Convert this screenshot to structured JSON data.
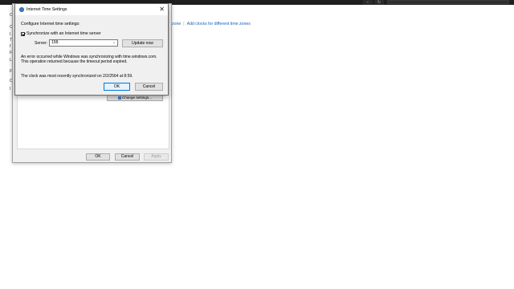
{
  "background": {
    "links": {
      "left_partial": "zone",
      "right": "Add clocks for different time zones"
    },
    "edge_letters": [
      "C",
      "C",
      "I",
      "T",
      "f",
      "F",
      "L",
      "F",
      "C",
      "I"
    ]
  },
  "date_time_dialog": {
    "change_settings_label": "Change settings...",
    "ok_label": "OK",
    "cancel_label": "Cancel",
    "apply_label": "Apply"
  },
  "internet_time_dialog": {
    "title": "Internet Time Settings",
    "heading": "Configure Internet time settings:",
    "sync_checkbox_label": "Synchronize with an Internet time server",
    "sync_checked": true,
    "server_label": "Server:",
    "server_value": "158.",
    "update_now_label": "Update now",
    "error_text": "An error occurred while Windows was synchronizing with time.windows.com.  This operation returned because the timeout period expired.",
    "last_sync_text": "The clock was most recently synchronized on 2/2/2564 at 8:59.",
    "ok_label": "OK",
    "cancel_label": "Cancel"
  },
  "colors": {
    "accent": "#0078d7",
    "link": "#1a5fb4",
    "dialog_bg": "#f0f0f0"
  }
}
